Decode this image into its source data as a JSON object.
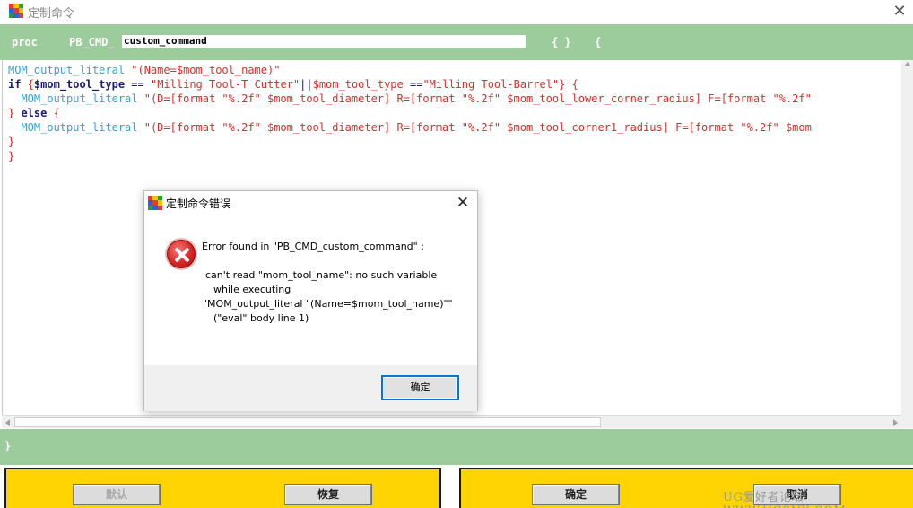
{
  "window": {
    "title": "定制命令",
    "close_glyph": "✕"
  },
  "proc_bar": {
    "keyword": "proc",
    "prefix": "PB_CMD_",
    "command_name": "custom_command",
    "braces": "{ }",
    "open_brace": "{"
  },
  "code_lines": [
    [
      {
        "t": "MOM_output_literal ",
        "c": "c-cmd"
      },
      {
        "t": "\"(Name=$mom_tool_name)\"",
        "c": "c-str"
      }
    ],
    [
      {
        "t": "if ",
        "c": "c-kw"
      },
      {
        "t": "{",
        "c": "c-red"
      },
      {
        "t": "$mom_tool_type",
        "c": "c-var"
      },
      {
        "t": " == ",
        "c": "c-plain"
      },
      {
        "t": "\"Milling Tool-T Cutter\"",
        "c": "c-str"
      },
      {
        "t": "||",
        "c": "c-plain"
      },
      {
        "t": "$mom_tool_type",
        "c": "c-str"
      },
      {
        "t": " ==",
        "c": "c-plain"
      },
      {
        "t": "\"Milling Tool-Barrel\"",
        "c": "c-str"
      },
      {
        "t": "} {",
        "c": "c-red"
      }
    ],
    [
      {
        "t": "  MOM_output_literal ",
        "c": "c-cmd"
      },
      {
        "t": "\"(D=[format \"%.2f\" $mom_tool_diameter] R=[format \"%.2f\" $mom_tool_lower_corner_radius] F=[format \"%.2f\"",
        "c": "c-str"
      }
    ],
    [
      {
        "t": "} ",
        "c": "c-red"
      },
      {
        "t": "else ",
        "c": "c-kw"
      },
      {
        "t": "{",
        "c": "c-red"
      }
    ],
    [
      {
        "t": "  MOM_output_literal ",
        "c": "c-cmd"
      },
      {
        "t": "\"(D=[format \"%.2f\" $mom_tool_diameter] R=[format \"%.2f\" $mom_tool_corner1_radius] F=[format \"%.2f\" $mom",
        "c": "c-str"
      }
    ],
    [
      {
        "t": "}",
        "c": "c-red"
      }
    ],
    [
      {
        "t": "}",
        "c": "c-red"
      }
    ]
  ],
  "closing_bar": {
    "brace": "}"
  },
  "buttons": {
    "default": "默认",
    "restore": "恢复",
    "ok": "确定",
    "cancel": "取消"
  },
  "watermark": "UG爱好者论坛 WWW.UGSNX.COM",
  "dialog": {
    "title": "定制命令错误",
    "close_glyph": "✕",
    "line1": "Error found in \"PB_CMD_custom_command\" :",
    "line2": "can't read \"mom_tool_name\": no such variable",
    "line3": "while executing",
    "line4": "\"MOM_output_literal \"(Name=$mom_tool_name)\"\"",
    "line5": "(\"eval\" body line 1)",
    "ok_label": "确定"
  },
  "colors": {
    "header_green": "#9ccc9c",
    "button_panel_yellow": "#ffd400",
    "error_red": "#d92626",
    "focus_blue": "#0078d7"
  },
  "icons": {
    "app": "app-icon-colored-grid",
    "error": "error-x-icon"
  }
}
